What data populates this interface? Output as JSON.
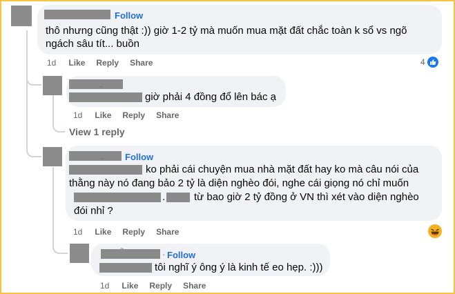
{
  "labels": {
    "follow": "Follow",
    "like": "Like",
    "reply": "Reply",
    "share": "Share",
    "dot": "·"
  },
  "comments": [
    {
      "timestamp": "1d",
      "lines": [
        "thô nhưng cũng thật :)) giờ 1-2 tỷ mà muốn mua mặt đất chắc toàn k sổ vs ngõ",
        "ngách sâu tít... buồn"
      ],
      "reaction_count": "4",
      "reaction_icon": "like-icon"
    },
    {
      "timestamp": "1d",
      "lines": [
        "giờ phải 4 đồng đổ lên bác ạ"
      ],
      "view_replies": "View 1 reply"
    },
    {
      "timestamp": "1d",
      "lines": [
        "ko phải cái chuyện mua nhà mặt đất hay ko mà câu nói của",
        "thằng này nó đang bảo 2 tỷ là diện nghèo đói, nghe cái giọng nó chỉ muốn",
        ".",
        "từ bao giờ 2 tỷ đồng ở VN thì xét vào diện nghèo",
        "đói nhỉ ?"
      ],
      "reaction_icon": "haha-icon"
    },
    {
      "timestamp": "1d",
      "lines": [
        "tôi nghĩ ý ông ý là kinh tế eo hẹp. :)))"
      ]
    }
  ],
  "colors": {
    "bubble": "#f0f2f5",
    "follow": "#216fdb",
    "meta": "#65676b",
    "like": "#1877f2",
    "haha": "#f7b125"
  }
}
